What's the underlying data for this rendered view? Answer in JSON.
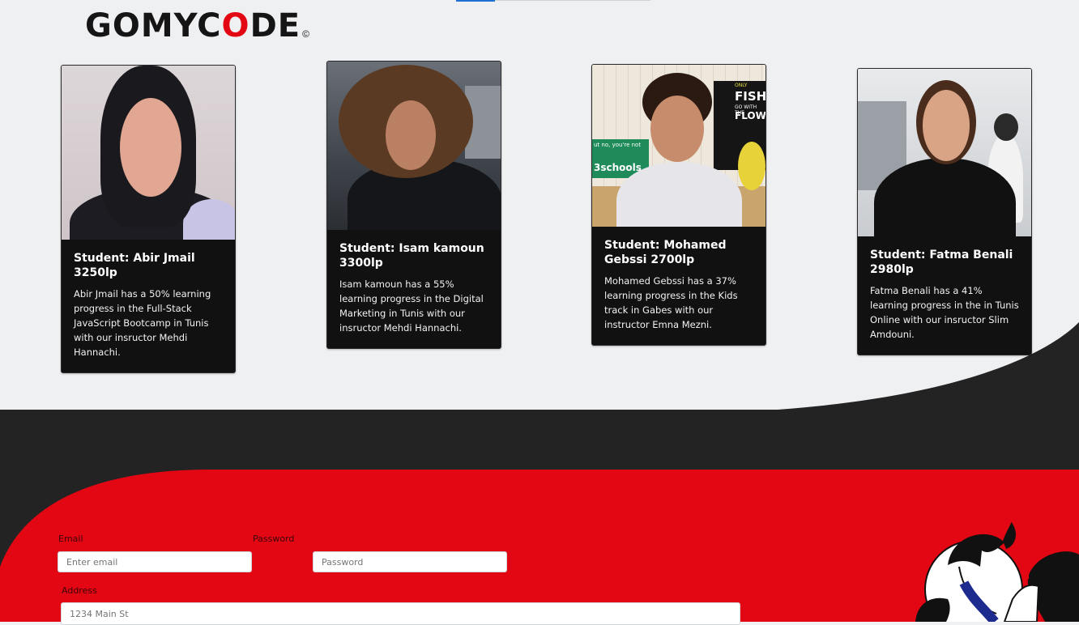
{
  "brand": {
    "logo_text_before": "GOMYC",
    "logo_text_accent": "O",
    "logo_text_after": "DE",
    "logo_mark": "©"
  },
  "students": [
    {
      "title": "Student: Abir Jmail 3250lp",
      "text": "Abir Jmail has a 50% learning progress in the Full-Stack JavaScript Bootcamp in Tunis with our insructor Mehdi Hannachi."
    },
    {
      "title": "Student: Isam kamoun 3300lp",
      "text": "Isam kamoun has a 55% learning progress in the Digital Marketing in Tunis with our insructor Mehdi Hannachi."
    },
    {
      "title": "Student: Mohamed Gebssi 2700lp",
      "text": "Mohamed Gebssi has a 37% learning progress in the Kids track in Gabes with our instructor Emna Mezni."
    },
    {
      "title": "Student: Fatma Benali 2980lp",
      "text": "Fatma Benali has a 41% learning progress in the in Tunis Online with our insructor Slim Amdouni."
    }
  ],
  "photo_signage": {
    "poster_line1": "ONLY",
    "poster_line2": "FISH",
    "poster_line3": "GO WITH THE",
    "poster_line4": "FLOW",
    "banner_top": "ut no, you're not",
    "banner_mid": "3schools"
  },
  "form": {
    "email_label": "Email",
    "email_placeholder": "Enter email",
    "password_label": "Password",
    "password_placeholder": "Password",
    "address_label": "Address",
    "address_placeholder": "1234 Main St"
  },
  "colors": {
    "accent_red": "#e30613",
    "dark": "#232323",
    "page_bg": "#eff0f2",
    "card_bg": "#111111"
  }
}
